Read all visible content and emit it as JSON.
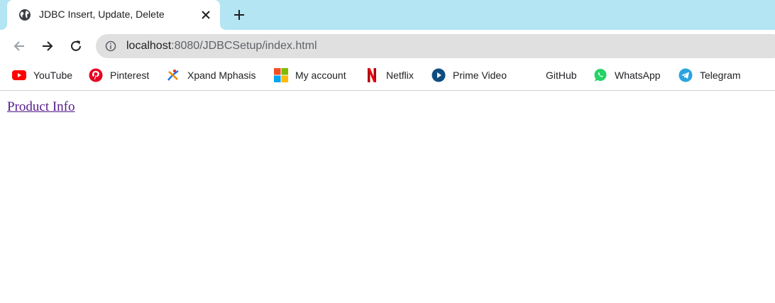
{
  "tab": {
    "title": "JDBC Insert, Update, Delete",
    "icon": "globe-icon"
  },
  "toolbar": {
    "url_host": "localhost",
    "url_path": ":8080/JDBCSetup/index.html"
  },
  "bookmarks": [
    {
      "label": "YouTube",
      "icon": "youtube-icon"
    },
    {
      "label": "Pinterest",
      "icon": "pinterest-icon"
    },
    {
      "label": "Xpand Mphasis",
      "icon": "xpand-icon"
    },
    {
      "label": "My account",
      "icon": "microsoft-icon"
    },
    {
      "label": "Netflix",
      "icon": "netflix-icon"
    },
    {
      "label": "Prime Video",
      "icon": "prime-video-icon"
    },
    {
      "label": "GitHub",
      "icon": "github-icon"
    },
    {
      "label": "WhatsApp",
      "icon": "whatsapp-icon"
    },
    {
      "label": "Telegram",
      "icon": "telegram-icon"
    }
  ],
  "page": {
    "link_text": "Product Info"
  },
  "colors": {
    "tabstrip": "#b3e5f2",
    "omnibox": "#e0e0e0",
    "visited_link": "#551a8b"
  }
}
